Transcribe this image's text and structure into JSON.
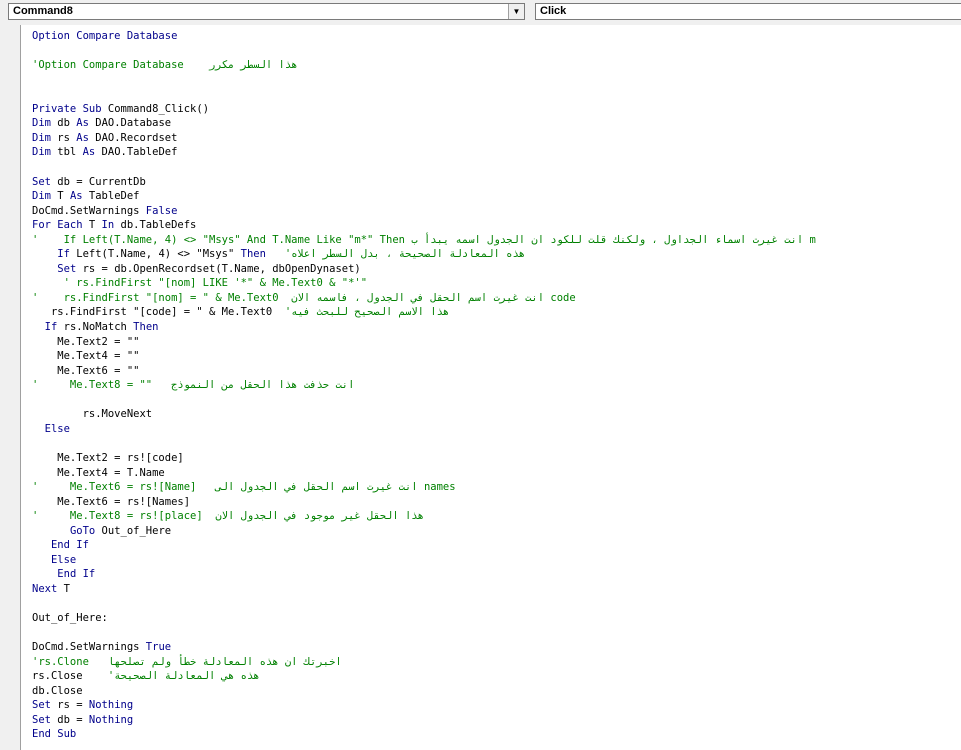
{
  "header": {
    "object_combo": "Command8",
    "procedure_combo": "Click"
  },
  "code_lines": [
    {
      "t": [
        {
          "x": "Option Compare Database",
          "c": "kw"
        }
      ]
    },
    {
      "t": []
    },
    {
      "t": [
        {
          "x": "'Option Compare Database    هذا السطر مكرر",
          "c": "cm"
        }
      ]
    },
    {
      "t": []
    },
    {
      "t": []
    },
    {
      "t": [
        {
          "x": "Private Sub",
          "c": "kw"
        },
        {
          "x": " Command8_Click()",
          "c": ""
        }
      ]
    },
    {
      "t": [
        {
          "x": "Dim",
          "c": "kw"
        },
        {
          "x": " db ",
          "c": ""
        },
        {
          "x": "As",
          "c": "kw"
        },
        {
          "x": " DAO.Database",
          "c": ""
        }
      ]
    },
    {
      "t": [
        {
          "x": "Dim",
          "c": "kw"
        },
        {
          "x": " rs ",
          "c": ""
        },
        {
          "x": "As",
          "c": "kw"
        },
        {
          "x": " DAO.Recordset",
          "c": ""
        }
      ]
    },
    {
      "t": [
        {
          "x": "Dim",
          "c": "kw"
        },
        {
          "x": " tbl ",
          "c": ""
        },
        {
          "x": "As",
          "c": "kw"
        },
        {
          "x": " DAO.TableDef",
          "c": ""
        }
      ]
    },
    {
      "t": []
    },
    {
      "t": [
        {
          "x": "Set",
          "c": "kw"
        },
        {
          "x": " db = CurrentDb",
          "c": ""
        }
      ]
    },
    {
      "t": [
        {
          "x": "Dim",
          "c": "kw"
        },
        {
          "x": " T ",
          "c": ""
        },
        {
          "x": "As",
          "c": "kw"
        },
        {
          "x": " TableDef",
          "c": ""
        }
      ]
    },
    {
      "t": [
        {
          "x": "DoCmd.SetWarnings ",
          "c": ""
        },
        {
          "x": "False",
          "c": "kw"
        }
      ]
    },
    {
      "t": [
        {
          "x": "For Each",
          "c": "kw"
        },
        {
          "x": " T ",
          "c": ""
        },
        {
          "x": "In",
          "c": "kw"
        },
        {
          "x": " db.TableDefs",
          "c": ""
        }
      ]
    },
    {
      "t": [
        {
          "x": "'    If Left(T.Name, 4) <> \"Msys\" And T.Name Like \"m*\" Then انت غيرت اسماء الجداول ، ولكنك قلت للكود ان الجدول اسمه يبدأ ب m",
          "c": "cm"
        }
      ]
    },
    {
      "t": [
        {
          "x": "    ",
          "c": ""
        },
        {
          "x": "If",
          "c": "kw"
        },
        {
          "x": " Left(T.Name, 4) <> \"Msys\" ",
          "c": ""
        },
        {
          "x": "Then",
          "c": "kw"
        },
        {
          "x": "   'هذه المعادلة الصحيحة ، بدل السطر اعلاه",
          "c": "cm"
        }
      ]
    },
    {
      "t": [
        {
          "x": "    ",
          "c": ""
        },
        {
          "x": "Set",
          "c": "kw"
        },
        {
          "x": " rs = db.OpenRecordset(T.Name, dbOpenDynaset)",
          "c": ""
        }
      ]
    },
    {
      "t": [
        {
          "x": "     ' rs.FindFirst \"[nom] LIKE '*\" & Me.Text0 & \"*'\"",
          "c": "cm"
        }
      ]
    },
    {
      "t": [
        {
          "x": "'    rs.FindFirst \"[nom] = \" & Me.Text0  انت غيرت اسم الحقل في الجدول ، فاسمه الان code",
          "c": "cm"
        }
      ]
    },
    {
      "t": [
        {
          "x": "   rs.FindFirst \"[code] = \" & Me.Text0  ",
          "c": ""
        },
        {
          "x": "'هذا الاسم الصحيح للبحث فيه",
          "c": "cm"
        }
      ]
    },
    {
      "t": [
        {
          "x": "  ",
          "c": ""
        },
        {
          "x": "If",
          "c": "kw"
        },
        {
          "x": " rs.NoMatch ",
          "c": ""
        },
        {
          "x": "Then",
          "c": "kw"
        }
      ]
    },
    {
      "t": [
        {
          "x": "    Me.Text2 = \"\"",
          "c": ""
        }
      ]
    },
    {
      "t": [
        {
          "x": "    Me.Text4 = \"\"",
          "c": ""
        }
      ]
    },
    {
      "t": [
        {
          "x": "    Me.Text6 = \"\"",
          "c": ""
        }
      ]
    },
    {
      "t": [
        {
          "x": "'     Me.Text8 = \"\"   انت حذفت هذا الحقل من النموذج",
          "c": "cm"
        }
      ]
    },
    {
      "t": []
    },
    {
      "t": [
        {
          "x": "        rs.MoveNext",
          "c": ""
        }
      ]
    },
    {
      "t": [
        {
          "x": "  ",
          "c": ""
        },
        {
          "x": "Else",
          "c": "kw"
        }
      ]
    },
    {
      "t": []
    },
    {
      "t": [
        {
          "x": "    Me.Text2 = rs![code]",
          "c": ""
        }
      ]
    },
    {
      "t": [
        {
          "x": "    Me.Text4 = T.Name",
          "c": ""
        }
      ]
    },
    {
      "t": [
        {
          "x": "'     Me.Text6 = rs![Name]   انت غيرت اسم الحقل في الجدول الى names",
          "c": "cm"
        }
      ]
    },
    {
      "t": [
        {
          "x": "    Me.Text6 = rs![Names]",
          "c": ""
        }
      ]
    },
    {
      "t": [
        {
          "x": "'     Me.Text8 = rs![place]  هذا الحقل غير موجود في الجدول الان",
          "c": "cm"
        }
      ]
    },
    {
      "t": [
        {
          "x": "      ",
          "c": ""
        },
        {
          "x": "GoTo",
          "c": "kw"
        },
        {
          "x": " Out_of_Here",
          "c": ""
        }
      ]
    },
    {
      "t": [
        {
          "x": "   ",
          "c": ""
        },
        {
          "x": "End If",
          "c": "kw"
        }
      ]
    },
    {
      "t": [
        {
          "x": "   ",
          "c": ""
        },
        {
          "x": "Else",
          "c": "kw"
        }
      ]
    },
    {
      "t": [
        {
          "x": "    ",
          "c": ""
        },
        {
          "x": "End If",
          "c": "kw"
        }
      ]
    },
    {
      "t": [
        {
          "x": "Next",
          "c": "kw"
        },
        {
          "x": " T",
          "c": ""
        }
      ]
    },
    {
      "t": []
    },
    {
      "t": [
        {
          "x": "Out_of_Here:",
          "c": ""
        }
      ]
    },
    {
      "t": []
    },
    {
      "t": [
        {
          "x": "DoCmd.SetWarnings ",
          "c": ""
        },
        {
          "x": "True",
          "c": "kw"
        }
      ]
    },
    {
      "t": [
        {
          "x": "'rs.Clone   اخبرتك ان هذه المعادلة خطأ ولم تصلحها",
          "c": "cm"
        }
      ]
    },
    {
      "t": [
        {
          "x": "rs.Close    ",
          "c": ""
        },
        {
          "x": "'هذه هي المعادلة الصحيحة",
          "c": "cm"
        }
      ]
    },
    {
      "t": [
        {
          "x": "db.Close",
          "c": ""
        }
      ]
    },
    {
      "t": [
        {
          "x": "Set",
          "c": "kw"
        },
        {
          "x": " rs = ",
          "c": ""
        },
        {
          "x": "Nothing",
          "c": "kw"
        }
      ]
    },
    {
      "t": [
        {
          "x": "Set",
          "c": "kw"
        },
        {
          "x": " db = ",
          "c": ""
        },
        {
          "x": "Nothing",
          "c": "kw"
        }
      ]
    },
    {
      "t": [
        {
          "x": "End Sub",
          "c": "kw"
        }
      ]
    }
  ]
}
